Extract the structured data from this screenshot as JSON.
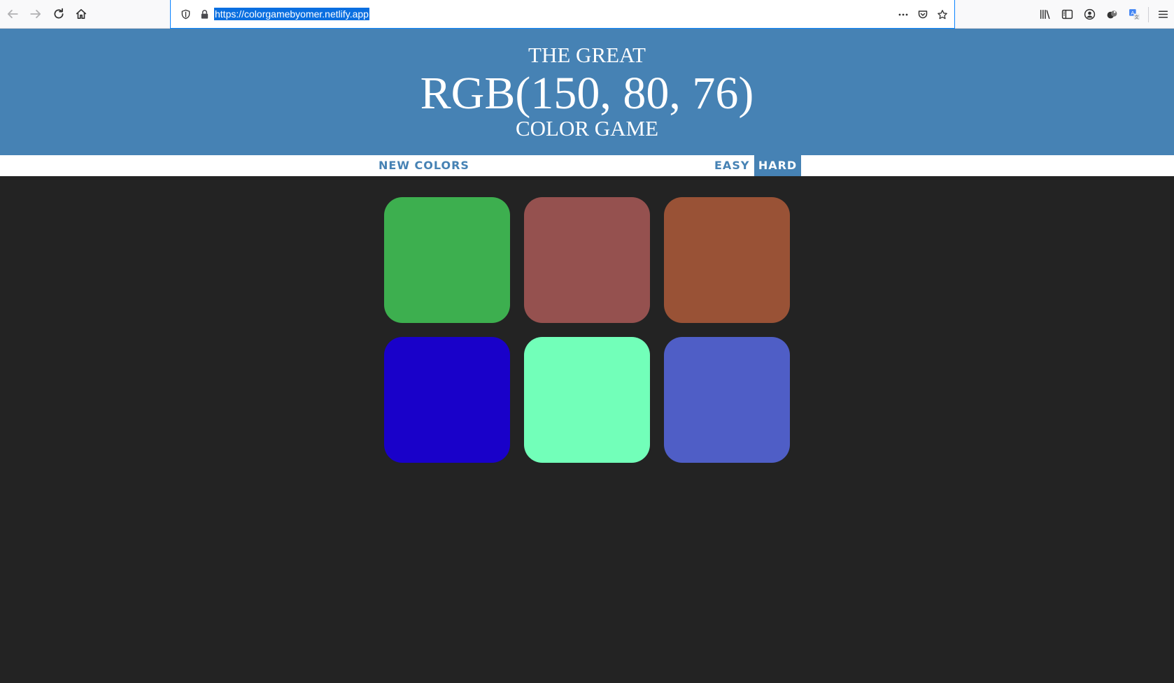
{
  "browser": {
    "url": "https://colorgamebyomer.netlify.app",
    "icons": {
      "back": "back-arrow-icon",
      "forward": "forward-arrow-icon",
      "reload": "reload-icon",
      "home": "home-icon",
      "shield": "shield-icon",
      "lock": "lock-icon",
      "more": "more-dots-icon",
      "pocket": "pocket-icon",
      "bookmark": "star-icon",
      "library": "library-icon",
      "sidebar": "sidebar-icon",
      "account": "account-icon",
      "extension": "extension-icon",
      "translate": "translate-icon",
      "menu": "hamburger-menu-icon"
    }
  },
  "header": {
    "line1": "THE GREAT",
    "target_color": "RGB(150, 80, 76)",
    "line3": "COLOR GAME",
    "background": "#4682b4"
  },
  "stripe": {
    "new_colors_label": "NEW COLORS",
    "easy_label": "EASY",
    "hard_label": "HARD",
    "selected_mode": "HARD"
  },
  "squares": [
    {
      "color": "#3daf4f"
    },
    {
      "color": "#95514f"
    },
    {
      "color": "#995236"
    },
    {
      "color": "#1901c9"
    },
    {
      "color": "#72ffb9"
    },
    {
      "color": "#4f5ec6"
    }
  ]
}
